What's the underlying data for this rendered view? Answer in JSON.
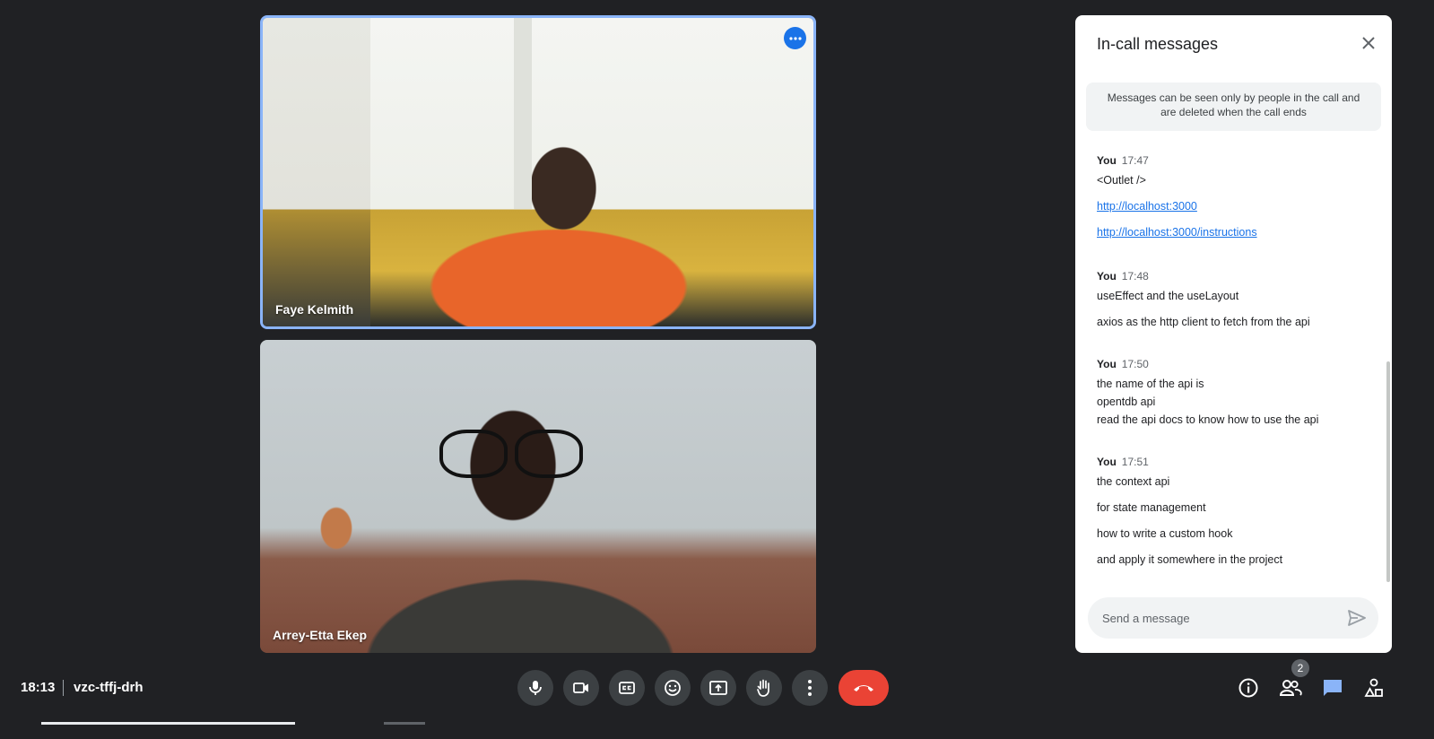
{
  "participants": [
    {
      "name": "Faye Kelmith",
      "active_speaker": true
    },
    {
      "name": "Arrey-Etta Ekep",
      "active_speaker": false
    }
  ],
  "chat": {
    "title": "In-call messages",
    "notice": "Messages can be seen only by people in the call and are deleted when the call ends",
    "groups": [
      {
        "author": "You",
        "time": "17:47",
        "lines": [
          "<Outlet />",
          "http://localhost:3000",
          "http://localhost:3000/instructions"
        ]
      },
      {
        "author": "You",
        "time": "17:48",
        "lines": [
          "useEffect and the useLayout",
          "axios as the http client to fetch from the api"
        ]
      },
      {
        "author": "You",
        "time": "17:50",
        "lines": [
          "the name of the api is",
          "opentdb api",
          "read the api docs to know how to use the api"
        ]
      },
      {
        "author": "You",
        "time": "17:51",
        "lines": [
          "the context api",
          "for state management",
          "how to write a custom hook",
          "and apply it somewhere in the project"
        ]
      }
    ],
    "composer_placeholder": "Send a message"
  },
  "footer": {
    "time": "18:13",
    "meeting_code": "vzc-tffj-drh",
    "people_count": "2"
  },
  "icons": {
    "mic": "microphone-icon",
    "camera": "video-camera-icon",
    "captions": "closed-captions-icon",
    "emoji": "emoji-icon",
    "present": "present-screen-icon",
    "hand": "raise-hand-icon",
    "more": "more-vert-icon",
    "end": "hang-up-icon",
    "info": "info-icon",
    "people": "people-icon",
    "chat": "chat-icon",
    "activities": "activities-icon"
  },
  "colors": {
    "accent": "#1a73e8",
    "end_call": "#ea4335",
    "background": "#202124"
  }
}
